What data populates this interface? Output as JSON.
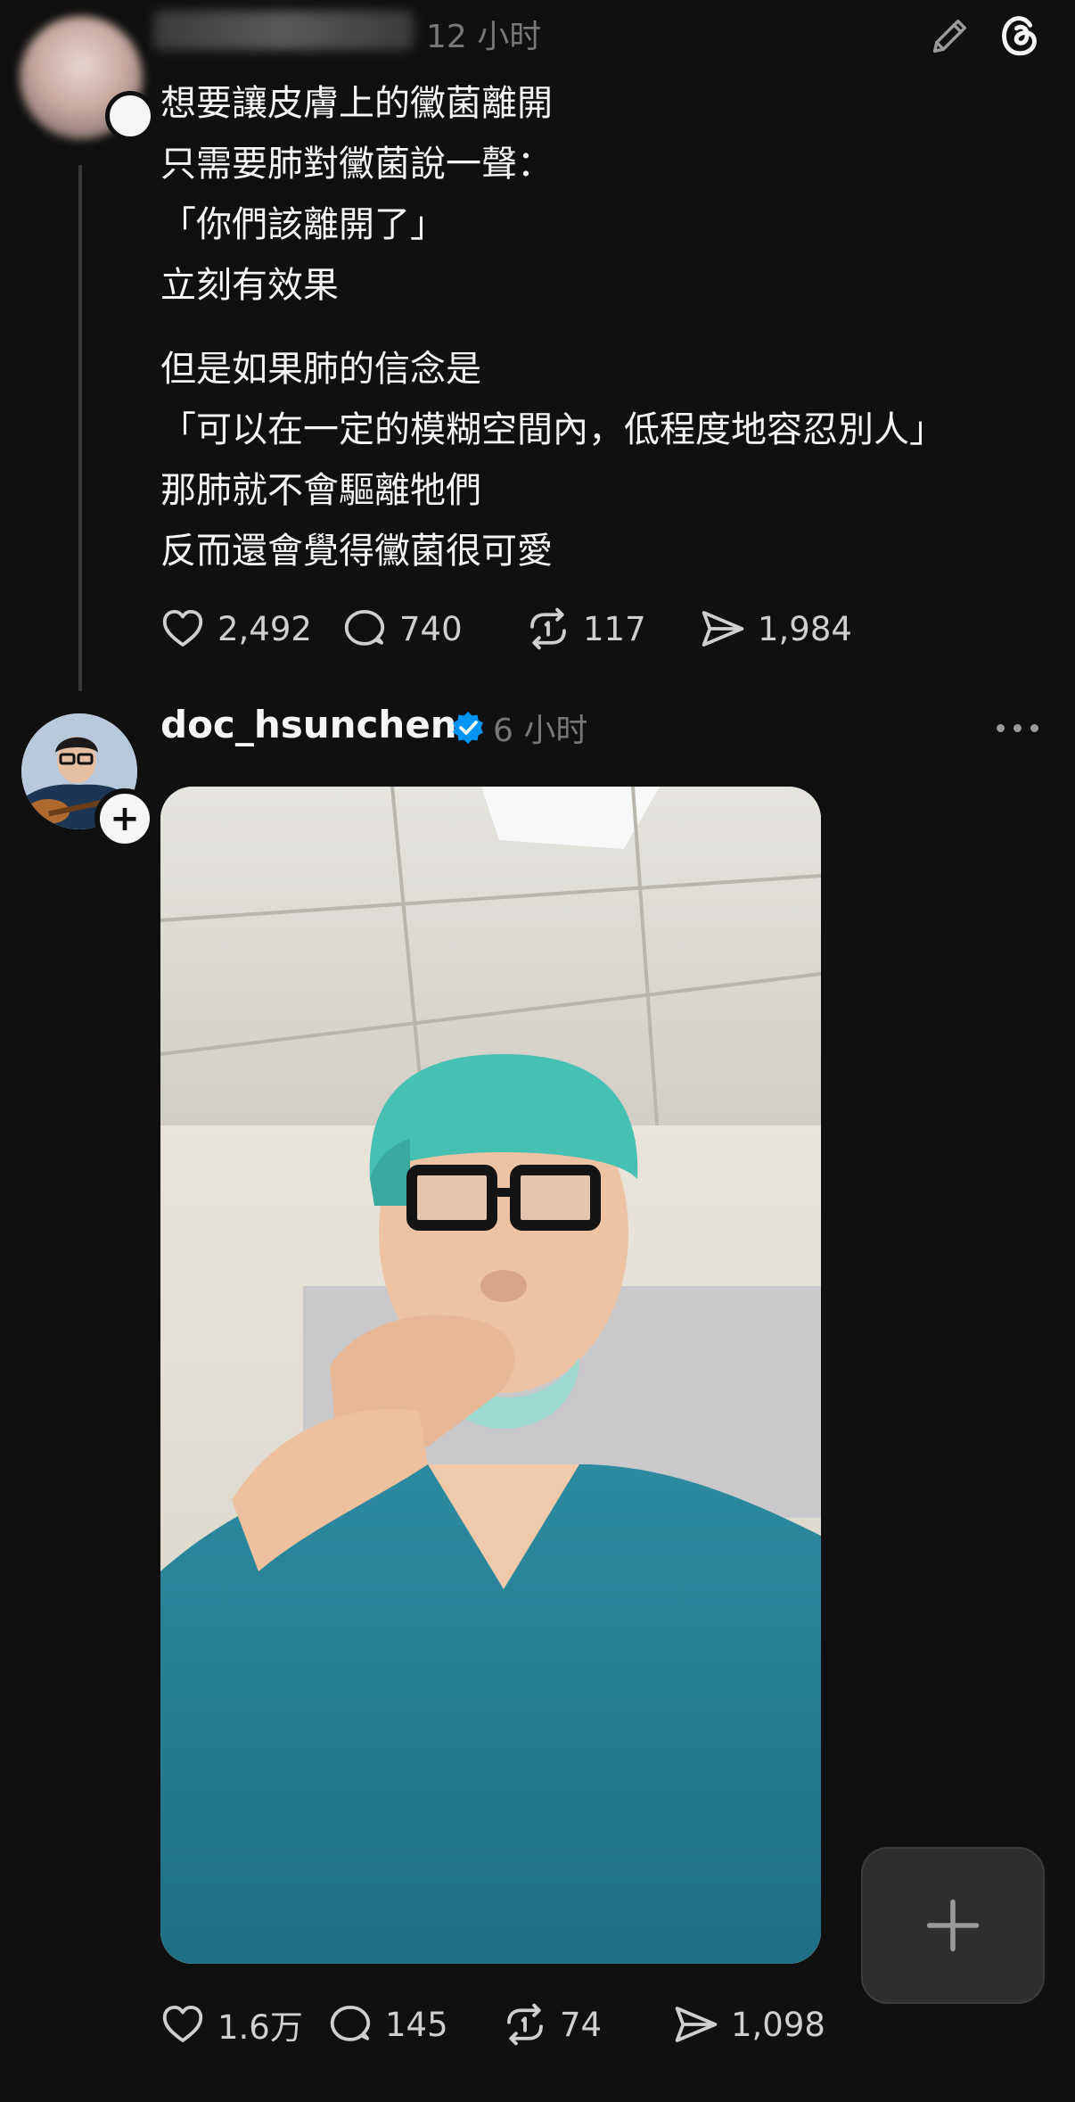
{
  "post1": {
    "time": "12 小时",
    "paragraphs": [
      [
        "想要讓皮膚上的黴菌離開",
        "只需要肺對黴菌說一聲：",
        "「你們該離開了」",
        "立刻有效果"
      ],
      [
        "但是如果肺的信念是",
        "「可以在一定的模糊空間內，低程度地容忍別人」",
        "那肺就不會驅離牠們",
        "反而還會覺得黴菌很可愛"
      ]
    ],
    "likes": "2,492",
    "replies": "740",
    "reposts": "117",
    "shares": "1,984"
  },
  "post2": {
    "username": "doc_hsunchen",
    "time": "6 小时",
    "likes": "1.6万",
    "replies": "145",
    "reposts": "74",
    "shares": "1,098"
  },
  "icons": {
    "compose": "pencil-icon",
    "app": "threads-logo-icon",
    "like": "heart-icon",
    "reply": "comment-icon",
    "repost": "repost-icon",
    "share": "send-icon",
    "verified": "verified-badge-icon",
    "more": "more-icon",
    "fab": "plus-icon"
  },
  "colors": {
    "background": "#101010",
    "text": "#f3f5f7",
    "muted": "#777777",
    "verified": "#0095f6"
  }
}
